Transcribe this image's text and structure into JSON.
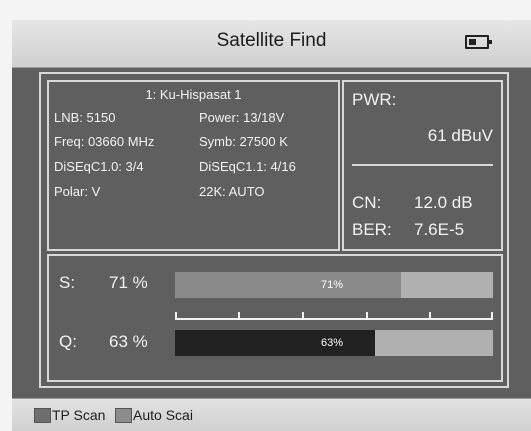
{
  "header": {
    "title": "Satellite Find",
    "battery_icon": "battery-icon"
  },
  "satellite": {
    "name": "1: Ku-Hispasat 1",
    "lnb": "LNB: 5150",
    "power": "Power: 13/18V",
    "freq": "Freq: 03660 MHz",
    "symb": "Symb: 27500 K",
    "diseqc10": "DiSEqC1.0: 3/4",
    "diseqc11": "DiSEqC1.1: 4/16",
    "polar": "Polar: V",
    "k22": "22K: AUTO"
  },
  "measurements": {
    "pwr_label": "PWR:",
    "pwr_value": "61  dBuV",
    "cn_label": "CN:",
    "cn_value": "12.0 dB",
    "ber_label": "BER:",
    "ber_value": "7.6E-5"
  },
  "signal": {
    "s_label": "S:",
    "s_value": "71  %",
    "s_bar_text": "71%",
    "s_level": 71,
    "q_label": "Q:",
    "q_value": "63  %",
    "q_bar_text": "63%",
    "q_level": 63
  },
  "footer": {
    "tp_scan": "TP Scan",
    "auto_scan": "Auto Scai",
    "tp_key_color": "#6e6e6e",
    "auto_key_color": "#8c8c8c"
  }
}
